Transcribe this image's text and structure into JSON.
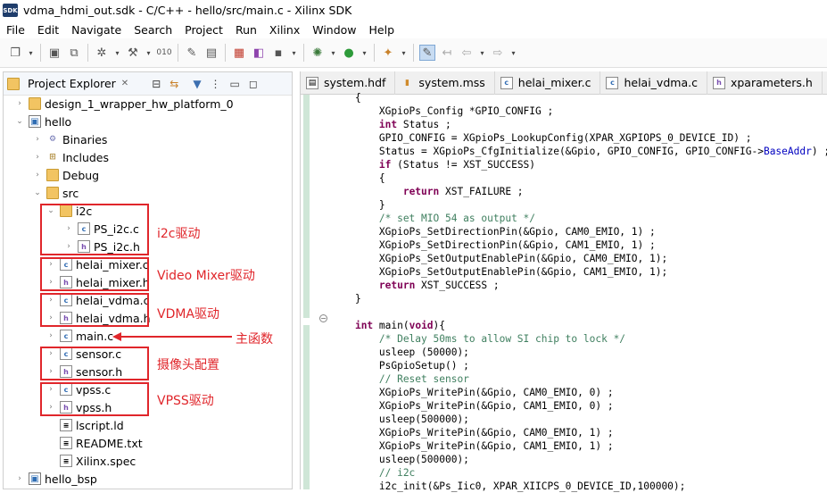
{
  "window": {
    "title": "vdma_hdmi_out.sdk - C/C++ - hello/src/main.c - Xilinx SDK",
    "app_icon": "SDK"
  },
  "menu": [
    "File",
    "Edit",
    "Navigate",
    "Search",
    "Project",
    "Run",
    "Xilinx",
    "Window",
    "Help"
  ],
  "toolbar": {
    "icons": [
      "new-icon",
      "save-icon",
      "save-all-icon",
      "build-icon",
      "hammer-icon",
      "binary-icon",
      "program-icon",
      "terminal-icon",
      "gear-icon",
      "debug-icon",
      "run-icon",
      "external-tool-icon",
      "edit-icon",
      "back-icon",
      "forward-icon"
    ]
  },
  "project_explorer": {
    "title": "Project Explorer",
    "close_glyph": "✕",
    "tree": [
      {
        "label": "design_1_wrapper_hw_platform_0",
        "icon": "folder-icon",
        "expanded": false
      },
      {
        "label": "hello",
        "icon": "project-icon",
        "expanded": true
      },
      {
        "label": "Binaries",
        "icon": "binaries-icon",
        "expanded": false
      },
      {
        "label": "Includes",
        "icon": "includes-icon",
        "expanded": false
      },
      {
        "label": "Debug",
        "icon": "folder-icon",
        "expanded": false
      },
      {
        "label": "src",
        "icon": "folder-icon",
        "expanded": true
      },
      {
        "label": "i2c",
        "icon": "folder-icon",
        "expanded": true
      },
      {
        "label": "PS_i2c.c",
        "icon": "c-file-icon"
      },
      {
        "label": "PS_i2c.h",
        "icon": "h-file-icon"
      },
      {
        "label": "helai_mixer.c",
        "icon": "c-file-icon"
      },
      {
        "label": "helai_mixer.h",
        "icon": "h-file-icon"
      },
      {
        "label": "helai_vdma.c",
        "icon": "c-file-icon"
      },
      {
        "label": "helai_vdma.h",
        "icon": "h-file-icon"
      },
      {
        "label": "main.c",
        "icon": "c-file-icon"
      },
      {
        "label": "sensor.c",
        "icon": "c-file-icon"
      },
      {
        "label": "sensor.h",
        "icon": "h-file-icon"
      },
      {
        "label": "vpss.c",
        "icon": "c-file-icon"
      },
      {
        "label": "vpss.h",
        "icon": "h-file-icon"
      },
      {
        "label": "lscript.ld",
        "icon": "text-file-icon"
      },
      {
        "label": "README.txt",
        "icon": "text-file-icon"
      },
      {
        "label": "Xilinx.spec",
        "icon": "text-file-icon"
      },
      {
        "label": "hello_bsp",
        "icon": "project-icon",
        "expanded": false
      }
    ]
  },
  "annotations": {
    "i2c": "i2c驱动",
    "mixer": "Video Mixer驱动",
    "vdma": "VDMA驱动",
    "main": "主函数",
    "sensor": "摄像头配置",
    "vpss": "VPSS驱动",
    "color": "#e0262b"
  },
  "editor_tabs": [
    {
      "label": "system.hdf",
      "icon": "file-icon"
    },
    {
      "label": "system.mss",
      "icon": "bsp-icon"
    },
    {
      "label": "helai_mixer.c",
      "icon": "c-file-icon"
    },
    {
      "label": "helai_vdma.c",
      "icon": "c-file-icon"
    },
    {
      "label": "xparameters.h",
      "icon": "h-file-icon"
    }
  ],
  "code_lines": [
    "    {",
    "        XGpioPs_Config *GPIO_CONFIG ;",
    "        int Status ;",
    "        GPIO_CONFIG = XGpioPs_LookupConfig(XPAR_XGPIOPS_0_DEVICE_ID) ;",
    "        Status = XGpioPs_CfgInitialize(&Gpio, GPIO_CONFIG, GPIO_CONFIG->BaseAddr) ;",
    "        if (Status != XST_SUCCESS)",
    "        {",
    "            return XST_FAILURE ;",
    "        }",
    "        /* set MIO 54 as output */",
    "        XGpioPs_SetDirectionPin(&Gpio, CAM0_EMIO, 1) ;",
    "        XGpioPs_SetDirectionPin(&Gpio, CAM1_EMIO, 1) ;",
    "        XGpioPs_SetOutputEnablePin(&Gpio, CAM0_EMIO, 1);",
    "        XGpioPs_SetOutputEnablePin(&Gpio, CAM1_EMIO, 1);",
    "        return XST_SUCCESS ;",
    "    }",
    "",
    "    int main(void){",
    "        /* Delay 50ms to allow SI chip to lock */",
    "        usleep (50000);",
    "        PsGpioSetup() ;",
    "        // Reset sensor",
    "        XGpioPs_WritePin(&Gpio, CAM0_EMIO, 0) ;",
    "        XGpioPs_WritePin(&Gpio, CAM1_EMIO, 0) ;",
    "        usleep(500000);",
    "        XGpioPs_WritePin(&Gpio, CAM0_EMIO, 1) ;",
    "        XGpioPs_WritePin(&Gpio, CAM1_EMIO, 1) ;",
    "        usleep(500000);",
    "        // i2c",
    "        i2c_init(&Ps_Iic0, XPAR_XIICPS_0_DEVICE_ID,100000);"
  ]
}
